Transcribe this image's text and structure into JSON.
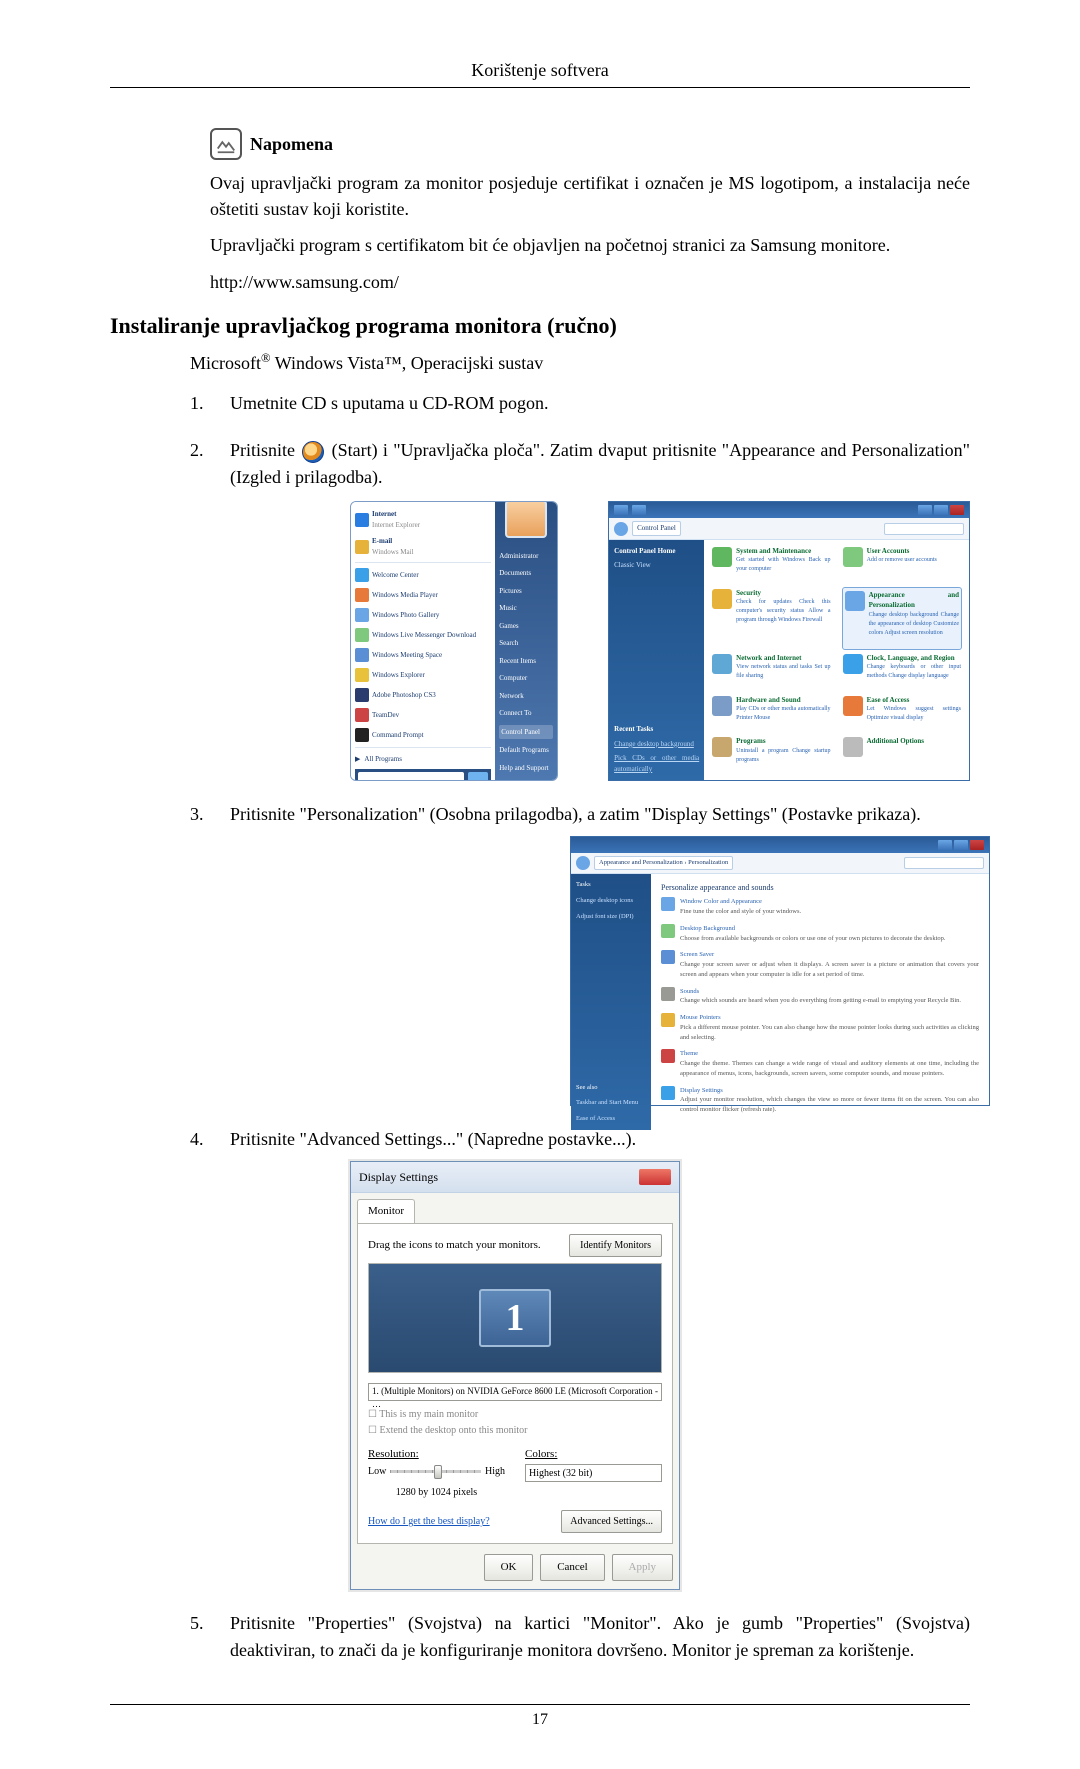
{
  "header": {
    "title": "Korištenje softvera"
  },
  "note": {
    "label": "Napomena",
    "para1": "Ovaj upravljački program za monitor posjeduje certifikat i označen je MS logotipom, a instalacija neće oštetiti sustav koji koristite.",
    "para2": "Upravljački program s certifikatom bit će objavljen na početnoj stranici za Samsung monitore.",
    "url": "http://www.samsung.com/"
  },
  "section": {
    "heading": "Instaliranje upravljačkog programa monitora (ručno)"
  },
  "subheading": {
    "prefix": "Microsoft",
    "middle": " Windows Vista™, Operacijski sustav"
  },
  "steps": {
    "s1": "Umetnite CD s uputama u CD-ROM pogon.",
    "s2a": "Pritisnite ",
    "s2b": "(Start) i \"Upravljačka ploča\". Zatim dvaput pritisnite \"Appearance and Personalization\" (Izgled i prilagodba).",
    "s3": "Pritisnite \"Personalization\" (Osobna prilagodba), a zatim \"Display Settings\" (Postavke prikaza).",
    "s4": "Pritisnite \"Advanced Settings...\" (Napredne postavke...).",
    "s5": "Pritisnite \"Properties\" (Svojstva) na kartici \"Monitor\". Ako je gumb \"Properties\" (Svojstva) deaktiviran, to znači da je konfiguriranje monitora dovršeno. Monitor je spreman za korištenje."
  },
  "startmenu": {
    "left": {
      "internet": "Internet",
      "internet_sub": "Internet Explorer",
      "email": "E-mail",
      "email_sub": "Windows Mail",
      "welcome": "Welcome Center",
      "wmp": "Windows Media Player",
      "gallery": "Windows Photo Gallery",
      "wlm": "Windows Live Messenger Download",
      "meeting": "Windows Meeting Space",
      "explorer": "Windows Explorer",
      "photoshop": "Adobe Photoshop CS3",
      "teamdev": "TeamDev",
      "cmd": "Command Prompt",
      "all": "All Programs"
    },
    "right": {
      "admin": "Administrator",
      "documents": "Documents",
      "pictures": "Pictures",
      "music": "Music",
      "games": "Games",
      "search": "Search",
      "recent": "Recent Items",
      "computer": "Computer",
      "network": "Network",
      "connect": "Connect To",
      "cp": "Control Panel",
      "defaults": "Default Programs",
      "help": "Help and Support"
    }
  },
  "controlpanel": {
    "title": "Control Panel",
    "crumb": "Control Panel",
    "side_home": "Control Panel Home",
    "side_classic": "Classic View",
    "cat_sys": "System and Maintenance",
    "cat_sys_sub": "Get started with Windows\nBack up your computer",
    "cat_sec": "Security",
    "cat_sec_sub": "Check for updates\nCheck this computer's security status\nAllow a program through Windows Firewall",
    "cat_net": "Network and Internet",
    "cat_net_sub": "View network status and tasks\nSet up file sharing",
    "cat_hw": "Hardware and Sound",
    "cat_hw_sub": "Play CDs or other media automatically\nPrinter\nMouse",
    "cat_prog": "Programs",
    "cat_prog_sub": "Uninstall a program\nChange startup programs",
    "cat_user": "User Accounts",
    "cat_user_sub": "Add or remove user accounts",
    "cat_app": "Appearance and Personalization",
    "cat_app_sub": "Change desktop background\nChange the appearance of desktop\nCustomize colors\nAdjust screen resolution",
    "cat_clock": "Clock, Language, and Region",
    "cat_clock_sub": "Change keyboards or other input methods\nChange display language",
    "cat_ease": "Ease of Access",
    "cat_ease_sub": "Let Windows suggest settings\nOptimize visual display",
    "cat_add": "Additional Options"
  },
  "personalization": {
    "crumb": "Appearance and Personalization › Personalization",
    "side_tasks": "Tasks",
    "side_icons": "Change desktop icons",
    "side_font": "Adjust font size (DPI)",
    "side_see": "See also",
    "side_tb": "Taskbar and Start Menu",
    "side_ea": "Ease of Access",
    "title": "Personalize appearance and sounds",
    "wca": "Window Color and Appearance",
    "wca_d": "Fine tune the color and style of your windows.",
    "db": "Desktop Background",
    "db_d": "Choose from available backgrounds or colors or use one of your own pictures to decorate the desktop.",
    "ss": "Screen Saver",
    "ss_d": "Change your screen saver or adjust when it displays. A screen saver is a picture or animation that covers your screen and appears when your computer is idle for a set period of time.",
    "snd": "Sounds",
    "snd_d": "Change which sounds are heard when you do everything from getting e-mail to emptying your Recycle Bin.",
    "mp": "Mouse Pointers",
    "mp_d": "Pick a different mouse pointer. You can also change how the mouse pointer looks during such activities as clicking and selecting.",
    "th": "Theme",
    "th_d": "Change the theme. Themes can change a wide range of visual and auditory elements at one time, including the appearance of menus, icons, backgrounds, screen savers, some computer sounds, and mouse pointers.",
    "ds": "Display Settings",
    "ds_d": "Adjust your monitor resolution, which changes the view so more or fewer items fit on the screen. You can also control monitor flicker (refresh rate)."
  },
  "displaysettings": {
    "title": "Display Settings",
    "tab": "Monitor",
    "instr": "Drag the icons to match your monitors.",
    "identify": "Identify Monitors",
    "mon": "1",
    "combo": "1. (Multiple Monitors) on NVIDIA GeForce 8600 LE (Microsoft Corporation - …",
    "chk1": "This is my main monitor",
    "chk2": "Extend the desktop onto this monitor",
    "res_label": "Resolution:",
    "low": "Low",
    "high": "High",
    "res_value": "1280 by 1024 pixels",
    "col_label": "Colors:",
    "col_value": "Highest (32 bit)",
    "help": "How do I get the best display?",
    "adv": "Advanced Settings...",
    "ok": "OK",
    "cancel": "Cancel",
    "apply": "Apply"
  },
  "footer": {
    "page": "17"
  }
}
